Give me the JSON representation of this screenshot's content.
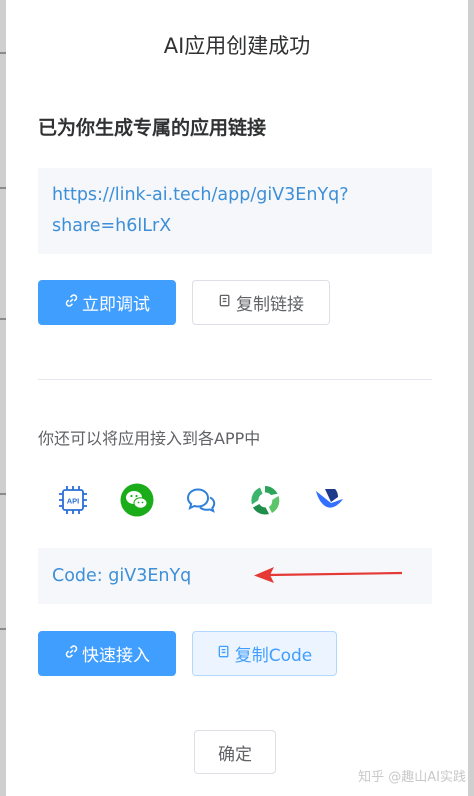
{
  "dialog": {
    "title": "AI应用创建成功",
    "section_title": "已为你生成专属的应用链接",
    "link_line1": "https://link-ai.tech/app/giV3EnYq?",
    "link_line2": "share=h6lLrX",
    "test_button": "立即调试",
    "copy_link_button": "复制链接",
    "hint": "你还可以将应用接入到各APP中",
    "apps": [
      {
        "name": "API",
        "icon": "api-chip-icon"
      },
      {
        "name": "WeChat",
        "icon": "wechat-icon"
      },
      {
        "name": "Chat",
        "icon": "chat-bubbles-icon"
      },
      {
        "name": "Circle",
        "icon": "green-circle-icon"
      },
      {
        "name": "Feishu",
        "icon": "feishu-icon"
      }
    ],
    "code_text": "Code: giV3EnYq",
    "quick_connect_button": "快速接入",
    "copy_code_button": "复制Code",
    "confirm_button": "确定"
  },
  "watermark": "知乎 @趣山AI实践",
  "colors": {
    "primary": "#409eff",
    "link_text": "#3d8fd8",
    "annotation_arrow": "#e53935"
  }
}
